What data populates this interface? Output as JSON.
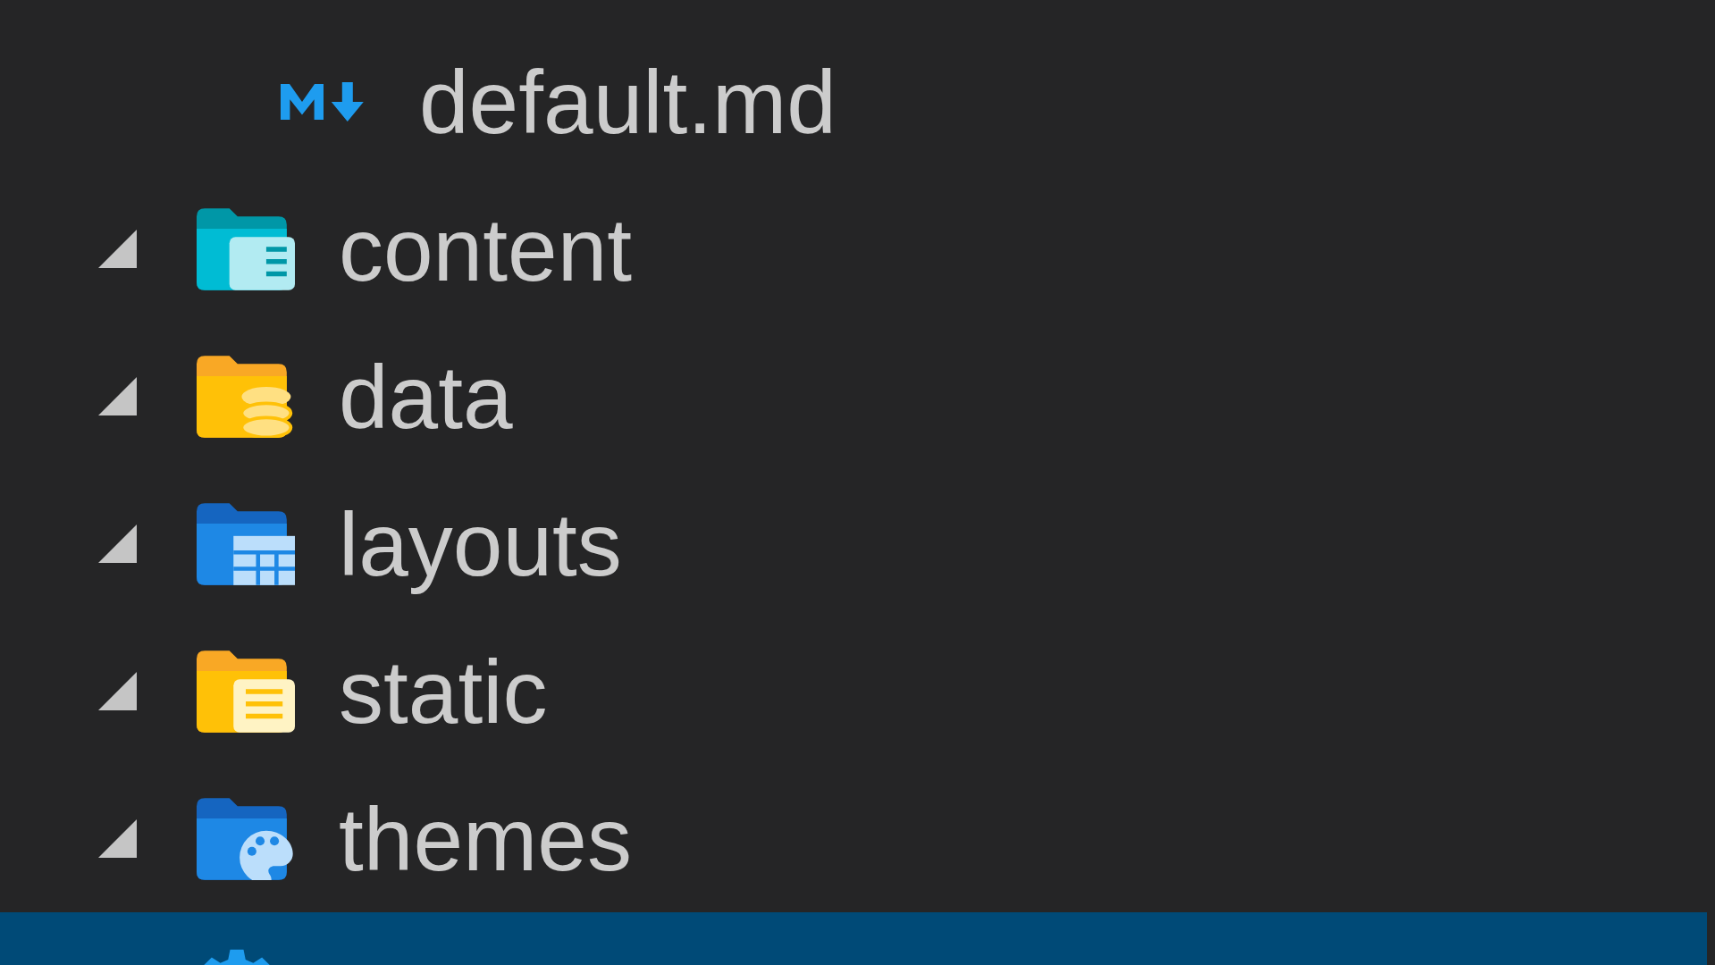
{
  "explorer": {
    "tree": [
      {
        "children": [
          {
            "label": "default.md",
            "kind": "file-markdown",
            "selected": false
          }
        ]
      },
      {
        "label": "content",
        "kind": "folder-docs",
        "expanded": false,
        "selected": false
      },
      {
        "label": "data",
        "kind": "folder-database",
        "expanded": false,
        "selected": false
      },
      {
        "label": "layouts",
        "kind": "folder-layout",
        "expanded": false,
        "selected": false
      },
      {
        "label": "static",
        "kind": "folder-files",
        "expanded": false,
        "selected": false
      },
      {
        "label": "themes",
        "kind": "folder-palette",
        "expanded": false,
        "selected": false
      },
      {
        "kind": "file-gear",
        "selected": true
      }
    ]
  }
}
